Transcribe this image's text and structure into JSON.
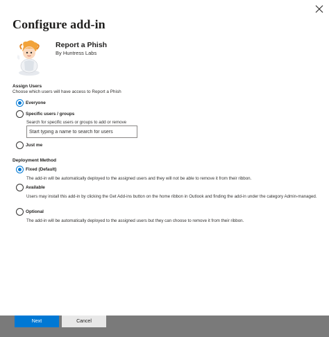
{
  "dialog": {
    "title": "Configure add-in",
    "close_icon": "close-icon"
  },
  "addin": {
    "name": "Report a Phish",
    "publisher": "By Huntress Labs",
    "icon": "cartoon-mascot-icon"
  },
  "assign_users": {
    "heading": "Assign Users",
    "description": "Choose which users will have access to Report a Phish",
    "options": [
      {
        "label": "Everyone",
        "checked": true
      },
      {
        "label": "Specific users / groups",
        "checked": false
      },
      {
        "label": "Just me",
        "checked": false
      }
    ],
    "search_hint": "Search for specific users or groups to add or remove",
    "search_placeholder": "Start typing a name to search for users"
  },
  "deployment": {
    "heading": "Deployment Method",
    "options": [
      {
        "label": "Fixed (Default)",
        "checked": true,
        "description": "The add-in will be automatically deployed to the assigned users and they will not be able to remove it from their ribbon."
      },
      {
        "label": "Available",
        "checked": false,
        "description": "Users may install this add-in by clicking the Get Add-ins button on the home ribbon in Outlook and finding the add-in under the category Admin-managed."
      },
      {
        "label": "Optional",
        "checked": false,
        "description": "The add-in will be automatically deployed to the assigned users but they can choose to remove it from their ribbon."
      }
    ]
  },
  "footer": {
    "next_label": "Next",
    "cancel_label": "Cancel"
  },
  "colors": {
    "accent": "#0078d4",
    "footer_bg": "#7a7a7a"
  }
}
